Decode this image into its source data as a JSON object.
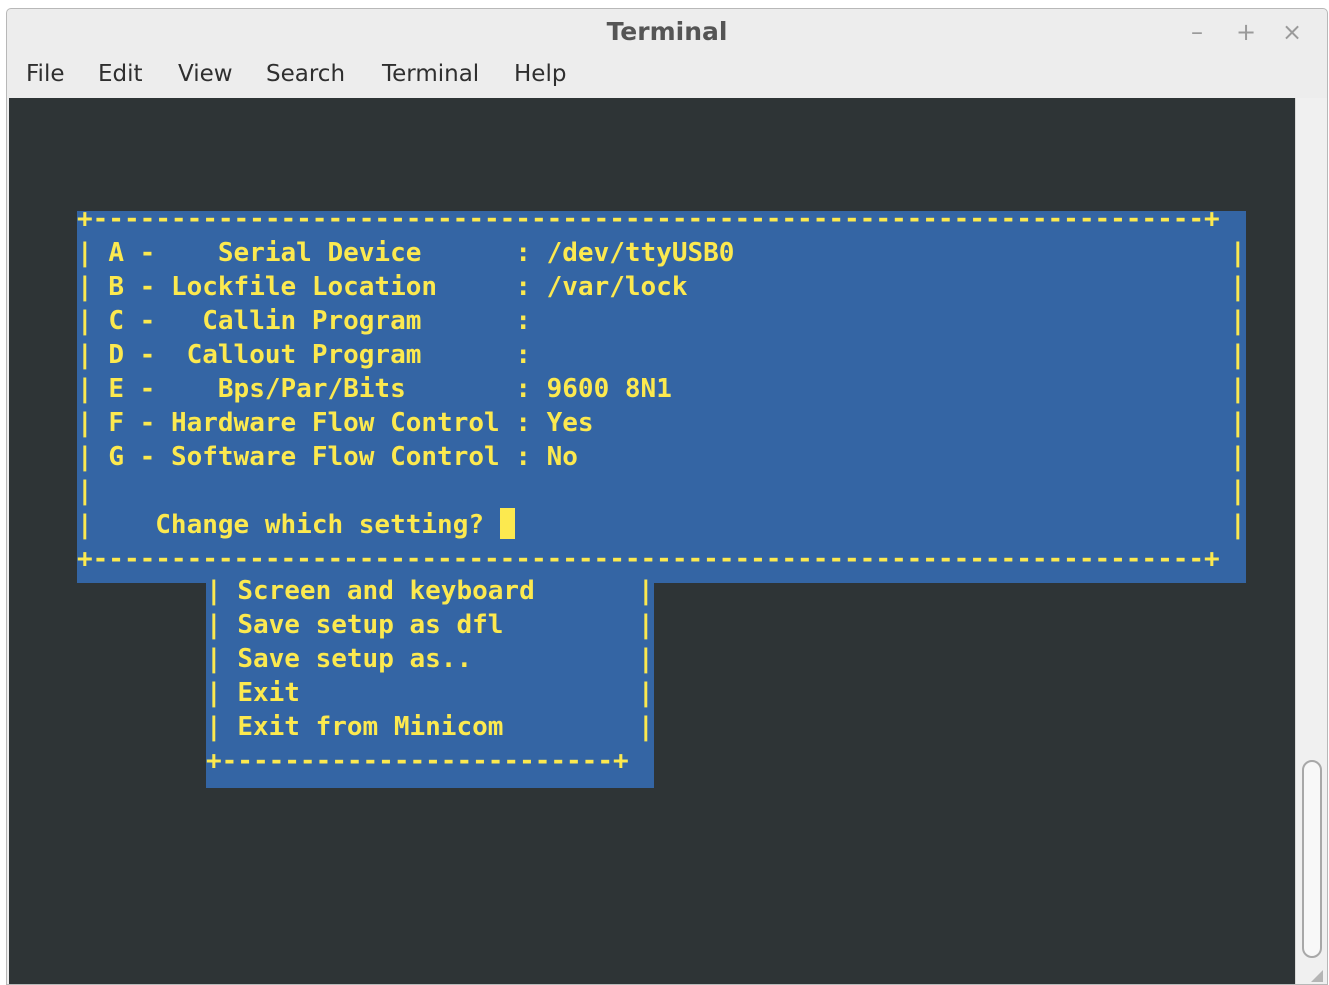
{
  "window": {
    "title": "Terminal",
    "controls": {
      "minimize": "–",
      "maximize": "+",
      "close": "×"
    }
  },
  "menubar": {
    "items": [
      "File",
      "Edit",
      "View",
      "Search",
      "Terminal",
      "Help"
    ]
  },
  "dialog": {
    "border_top": "+-----------------------------------------------------------------------+",
    "settings": [
      {
        "key": "A",
        "label": "   Serial Device      ",
        "value": "/dev/ttyUSB0"
      },
      {
        "key": "B",
        "label": "Lockfile Location     ",
        "value": "/var/lock"
      },
      {
        "key": "C",
        "label": "  Callin Program      ",
        "value": ""
      },
      {
        "key": "D",
        "label": " Callout Program      ",
        "value": ""
      },
      {
        "key": "E",
        "label": "   Bps/Par/Bits       ",
        "value": "9600 8N1"
      },
      {
        "key": "F",
        "label": "Hardware Flow Control ",
        "value": "Yes"
      },
      {
        "key": "G",
        "label": "Software Flow Control ",
        "value": "No"
      }
    ],
    "prompt": "Change which setting? ",
    "border_bottom": "+-----------------------------------------------------------------------+"
  },
  "config_menu": {
    "items": [
      "Screen and keyboard",
      "Save setup as dfl",
      "Save setup as..",
      "Exit",
      "Exit from Minicom"
    ],
    "border_bottom": "+-------------------------+"
  },
  "colors": {
    "terminal_bg": "#2e3436",
    "dialog_bg": "#3465a4",
    "text": "#fce94f"
  }
}
